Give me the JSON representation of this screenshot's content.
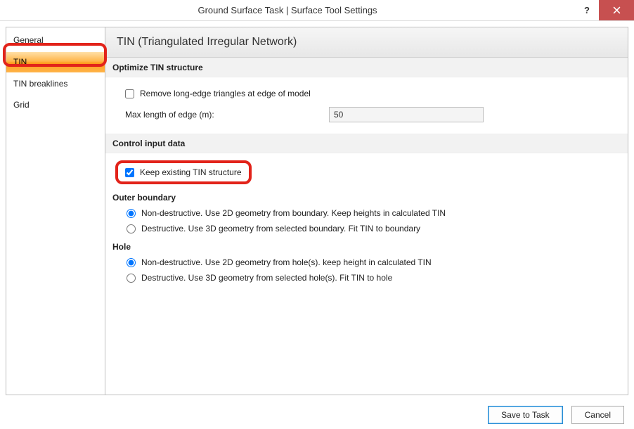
{
  "title": "Ground Surface Task | Surface Tool Settings",
  "sidebar": {
    "items": [
      {
        "label": "General"
      },
      {
        "label": "TIN"
      },
      {
        "label": "TIN breaklines"
      },
      {
        "label": "Grid"
      }
    ]
  },
  "panel": {
    "heading": "TIN (Triangulated Irregular Network)",
    "optimize": {
      "title": "Optimize TIN structure",
      "remove_long_edge": "Remove long-edge triangles at edge of model",
      "max_length_label": "Max length of edge (m):",
      "max_length_value": "50"
    },
    "control": {
      "title": "Control input data",
      "keep_existing": "Keep existing TIN structure"
    },
    "outer": {
      "title": "Outer boundary",
      "nondestructive": "Non-destructive. Use 2D geometry from boundary. Keep heights in calculated TIN",
      "destructive": "Destructive. Use 3D geometry from selected boundary. Fit TIN to boundary"
    },
    "hole": {
      "title": "Hole",
      "nondestructive": "Non-destructive. Use 2D geometry from hole(s). keep height in calculated TIN",
      "destructive": "Destructive. Use 3D geometry from selected hole(s). Fit TIN to hole"
    }
  },
  "footer": {
    "save": "Save to Task",
    "cancel": "Cancel"
  }
}
